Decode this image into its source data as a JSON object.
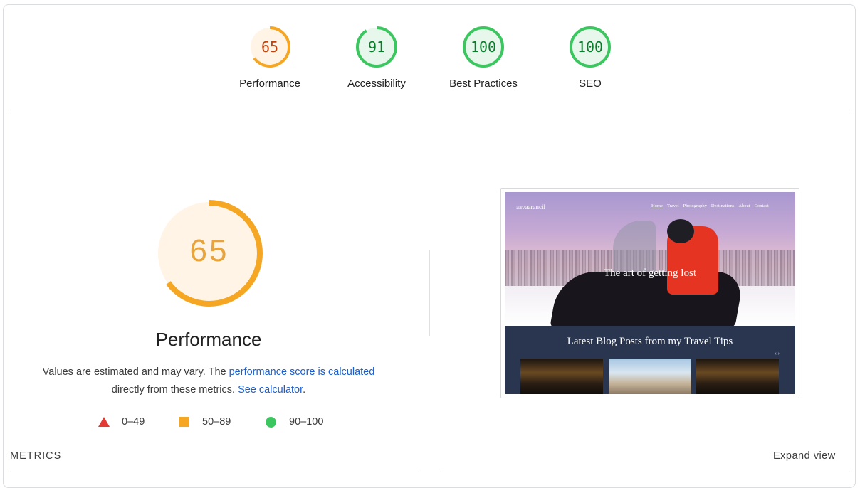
{
  "gauges": [
    {
      "score": "65",
      "value": 0.65,
      "label": "Performance",
      "color": "#f5a623",
      "fill": "#fff4e6",
      "text_color": "#c0410b"
    },
    {
      "score": "91",
      "value": 0.91,
      "label": "Accessibility",
      "color": "#3cc65f",
      "fill": "#e8f7ec",
      "text_color": "#0a7d2c"
    },
    {
      "score": "100",
      "value": 1.0,
      "label": "Best Practices",
      "color": "#3cc65f",
      "fill": "#e8f7ec",
      "text_color": "#0a7d2c"
    },
    {
      "score": "100",
      "value": 1.0,
      "label": "SEO",
      "color": "#3cc65f",
      "fill": "#e8f7ec",
      "text_color": "#0a7d2c"
    }
  ],
  "performance": {
    "score": "65",
    "value": 0.65,
    "title": "Performance",
    "desc_prefix": "Values are estimated and may vary. The ",
    "desc_link1": "performance score is calculated",
    "desc_middle": "directly from these metrics. ",
    "desc_link2": "See calculator",
    "desc_suffix": "."
  },
  "legend": {
    "fail": "0–49",
    "average": "50–89",
    "pass": "90–100"
  },
  "screenshot": {
    "site_name": "aavaarancil",
    "nav": [
      "Home",
      "Travel",
      "Photography",
      "Destinations",
      "About",
      "Contact"
    ],
    "hero_title": "The art of getting lost",
    "blog_title": "Latest Blog Posts from my Travel Tips",
    "arrows": "‹ ›"
  },
  "metrics_label": "METRICS",
  "expand_label": "Expand view",
  "colors": {
    "pass": "#3cc65f",
    "average": "#f5a623",
    "fail": "#e53935",
    "link": "#1a5fd1"
  }
}
